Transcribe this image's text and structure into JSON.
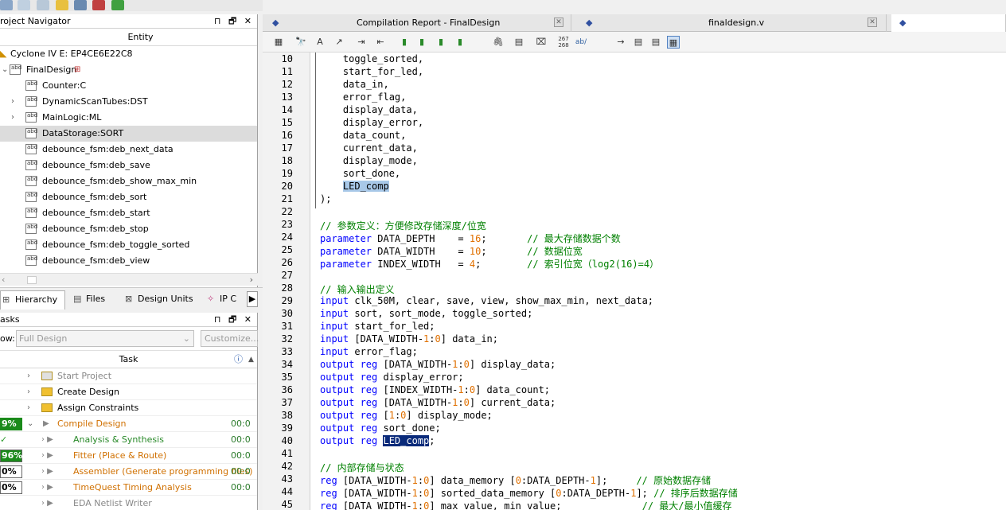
{
  "toolbar_icons": [
    "search-replace-icon",
    "pin-icon",
    "edit-icon",
    "lock-icon",
    "chip-icon",
    "compile-icon",
    "check-icon"
  ],
  "navigator": {
    "title": "roject Navigator",
    "controls": "▏☐✕",
    "column_header": "Entity",
    "device": "Cyclone IV E: EP4CE6E22C8",
    "top": "FinalDesign",
    "items": [
      {
        "label": "Counter:C",
        "expandable": false,
        "selected": false
      },
      {
        "label": "DynamicScanTubes:DST",
        "expandable": true,
        "selected": false
      },
      {
        "label": "MainLogic:ML",
        "expandable": true,
        "selected": false
      },
      {
        "label": "DataStorage:SORT",
        "expandable": false,
        "selected": true
      },
      {
        "label": "debounce_fsm:deb_next_data",
        "expandable": false,
        "selected": false
      },
      {
        "label": "debounce_fsm:deb_save",
        "expandable": false,
        "selected": false
      },
      {
        "label": "debounce_fsm:deb_show_max_min",
        "expandable": false,
        "selected": false
      },
      {
        "label": "debounce_fsm:deb_sort",
        "expandable": false,
        "selected": false
      },
      {
        "label": "debounce_fsm:deb_start",
        "expandable": false,
        "selected": false
      },
      {
        "label": "debounce_fsm:deb_stop",
        "expandable": false,
        "selected": false
      },
      {
        "label": "debounce_fsm:deb_toggle_sorted",
        "expandable": false,
        "selected": false
      },
      {
        "label": "debounce_fsm:deb_view",
        "expandable": false,
        "selected": false
      }
    ],
    "tabs": [
      "Hierarchy",
      "Files",
      "Design Units",
      "IP C"
    ]
  },
  "tasks": {
    "title": "asks",
    "flow_label": "ow:",
    "flow_value": "Full Design",
    "customize": "Customize...",
    "column_header": "Task",
    "rows": [
      {
        "label": "Start Project",
        "style": "gray",
        "pct": "",
        "time": "",
        "folder": true
      },
      {
        "label": "Create Design",
        "style": "normal",
        "pct": "",
        "time": "",
        "folder": true
      },
      {
        "label": "Assign Constraints",
        "style": "normal",
        "pct": "",
        "time": "",
        "folder": true
      },
      {
        "label": "Compile Design",
        "style": "orange",
        "pct": "9%",
        "time": "00:0",
        "folder": false
      },
      {
        "label": "Analysis & Synthesis",
        "style": "green",
        "pct": "",
        "time": "00:0",
        "folder": false
      },
      {
        "label": "Fitter (Place & Route)",
        "style": "orange",
        "pct": "96%",
        "time": "00:0",
        "folder": false
      },
      {
        "label": "Assembler (Generate programming files)",
        "style": "orange",
        "pct": "0%",
        "time": "00:0",
        "folder": false
      },
      {
        "label": "TimeQuest Timing Analysis",
        "style": "orange",
        "pct": "0%",
        "time": "00:0",
        "folder": false
      },
      {
        "label": "EDA Netlist Writer",
        "style": "gray",
        "pct": "",
        "time": "",
        "folder": false
      }
    ]
  },
  "doc_tabs": [
    {
      "label": "Compilation Report - FinalDesign",
      "active": false
    },
    {
      "label": "finaldesign.v",
      "active": false
    },
    {
      "label": "",
      "active": true
    }
  ],
  "editor_icons": [
    "insert-icon",
    "find-icon",
    "replace-icon",
    "goto-icon",
    "indent-icon",
    "outdent-icon",
    "bookmark-icon",
    "bookmark-next-icon",
    "bookmark-prev-icon",
    "bookmark-clear-icon",
    "attach-icon",
    "template-icon",
    "comment-icon",
    "line-numbers-icon",
    "spell-icon",
    "wrap-icon",
    "split-icon",
    "view1-icon",
    "view2-icon"
  ],
  "editor_text_icons": {
    "line_numbers": "267\n268",
    "spell": "ab/"
  },
  "code": [
    {
      "n": "10",
      "parts": [
        [
          "",
          "    toggle_sorted,"
        ]
      ]
    },
    {
      "n": "11",
      "parts": [
        [
          "",
          "    start_for_led,"
        ]
      ]
    },
    {
      "n": "12",
      "parts": [
        [
          "",
          "    data_in,"
        ]
      ]
    },
    {
      "n": "13",
      "parts": [
        [
          "",
          "    error_flag,"
        ]
      ]
    },
    {
      "n": "14",
      "parts": [
        [
          "",
          "    display_data,"
        ]
      ]
    },
    {
      "n": "15",
      "parts": [
        [
          "",
          "    display_error,"
        ]
      ]
    },
    {
      "n": "16",
      "parts": [
        [
          "",
          "    data_count,"
        ]
      ]
    },
    {
      "n": "17",
      "parts": [
        [
          "",
          "    current_data,"
        ]
      ]
    },
    {
      "n": "18",
      "parts": [
        [
          "",
          "    display_mode,"
        ]
      ]
    },
    {
      "n": "19",
      "parts": [
        [
          "",
          "    sort_done,"
        ]
      ]
    },
    {
      "n": "20",
      "parts": [
        [
          "",
          "    "
        ],
        [
          "hl1",
          "LED_comp"
        ]
      ]
    },
    {
      "n": "21",
      "parts": [
        [
          "",
          ");"
        ]
      ]
    },
    {
      "n": "22",
      "parts": [
        [
          "",
          ""
        ]
      ]
    },
    {
      "n": "23",
      "parts": [
        [
          "cm",
          "// 参数定义：方便修改存储深度/位宽"
        ]
      ]
    },
    {
      "n": "24",
      "parts": [
        [
          "kw",
          "parameter"
        ],
        [
          "",
          " DATA_DEPTH    = "
        ],
        [
          "num",
          "16"
        ],
        [
          "",
          ";       "
        ],
        [
          "cm",
          "// 最大存储数据个数"
        ]
      ]
    },
    {
      "n": "25",
      "parts": [
        [
          "kw",
          "parameter"
        ],
        [
          "",
          " DATA_WIDTH    = "
        ],
        [
          "num",
          "10"
        ],
        [
          "",
          ";       "
        ],
        [
          "cm",
          "// 数据位宽"
        ]
      ]
    },
    {
      "n": "26",
      "parts": [
        [
          "kw",
          "parameter"
        ],
        [
          "",
          " INDEX_WIDTH   = "
        ],
        [
          "num",
          "4"
        ],
        [
          "",
          ";        "
        ],
        [
          "cm",
          "// 索引位宽（log2(16)=4）"
        ]
      ]
    },
    {
      "n": "27",
      "parts": [
        [
          "",
          ""
        ]
      ]
    },
    {
      "n": "28",
      "parts": [
        [
          "cm",
          "// 输入输出定义"
        ]
      ]
    },
    {
      "n": "29",
      "parts": [
        [
          "kw",
          "input"
        ],
        [
          "",
          " clk_50M, clear, save, view, show_max_min, next_data;"
        ]
      ]
    },
    {
      "n": "30",
      "parts": [
        [
          "kw",
          "input"
        ],
        [
          "",
          " sort, sort_mode, toggle_sorted;"
        ]
      ]
    },
    {
      "n": "31",
      "parts": [
        [
          "kw",
          "input"
        ],
        [
          "",
          " start_for_led;"
        ]
      ]
    },
    {
      "n": "32",
      "parts": [
        [
          "kw",
          "input"
        ],
        [
          "",
          " [DATA_WIDTH-"
        ],
        [
          "num",
          "1"
        ],
        [
          "",
          ":"
        ],
        [
          "num",
          "0"
        ],
        [
          "",
          "] data_in;"
        ]
      ]
    },
    {
      "n": "33",
      "parts": [
        [
          "kw",
          "input"
        ],
        [
          "",
          " error_flag;"
        ]
      ]
    },
    {
      "n": "34",
      "parts": [
        [
          "kw",
          "output reg"
        ],
        [
          "",
          " [DATA_WIDTH-"
        ],
        [
          "num",
          "1"
        ],
        [
          "",
          ":"
        ],
        [
          "num",
          "0"
        ],
        [
          "",
          "] display_data;"
        ]
      ]
    },
    {
      "n": "35",
      "parts": [
        [
          "kw",
          "output reg"
        ],
        [
          "",
          " display_error;"
        ]
      ]
    },
    {
      "n": "36",
      "parts": [
        [
          "kw",
          "output reg"
        ],
        [
          "",
          " [INDEX_WIDTH-"
        ],
        [
          "num",
          "1"
        ],
        [
          "",
          ":"
        ],
        [
          "num",
          "0"
        ],
        [
          "",
          "] data_count;"
        ]
      ]
    },
    {
      "n": "37",
      "parts": [
        [
          "kw",
          "output reg"
        ],
        [
          "",
          " [DATA_WIDTH-"
        ],
        [
          "num",
          "1"
        ],
        [
          "",
          ":"
        ],
        [
          "num",
          "0"
        ],
        [
          "",
          "] current_data;"
        ]
      ]
    },
    {
      "n": "38",
      "parts": [
        [
          "kw",
          "output reg"
        ],
        [
          "",
          " ["
        ],
        [
          "num",
          "1"
        ],
        [
          "",
          ":"
        ],
        [
          "num",
          "0"
        ],
        [
          "",
          "] display_mode;"
        ]
      ]
    },
    {
      "n": "39",
      "parts": [
        [
          "kw",
          "output reg"
        ],
        [
          "",
          " sort_done;"
        ]
      ]
    },
    {
      "n": "40",
      "parts": [
        [
          "kw",
          "output reg"
        ],
        [
          "",
          " "
        ],
        [
          "hl2",
          "LED_comp"
        ],
        [
          "",
          ";"
        ]
      ]
    },
    {
      "n": "41",
      "parts": [
        [
          "",
          ""
        ]
      ]
    },
    {
      "n": "42",
      "parts": [
        [
          "cm",
          "// 内部存储与状态"
        ]
      ]
    },
    {
      "n": "43",
      "parts": [
        [
          "kw",
          "reg"
        ],
        [
          "",
          " [DATA_WIDTH-"
        ],
        [
          "num",
          "1"
        ],
        [
          "",
          ":"
        ],
        [
          "num",
          "0"
        ],
        [
          "",
          "] data_memory ["
        ],
        [
          "num",
          "0"
        ],
        [
          "",
          ":DATA_DEPTH-"
        ],
        [
          "num",
          "1"
        ],
        [
          "",
          "];     "
        ],
        [
          "cm",
          "// 原始数据存储"
        ]
      ]
    },
    {
      "n": "44",
      "parts": [
        [
          "kw",
          "reg"
        ],
        [
          "",
          " [DATA_WIDTH-"
        ],
        [
          "num",
          "1"
        ],
        [
          "",
          ":"
        ],
        [
          "num",
          "0"
        ],
        [
          "",
          "] sorted_data_memory ["
        ],
        [
          "num",
          "0"
        ],
        [
          "",
          ":DATA_DEPTH-"
        ],
        [
          "num",
          "1"
        ],
        [
          "",
          "]; "
        ],
        [
          "cm",
          "// 排序后数据存储"
        ]
      ]
    },
    {
      "n": "45",
      "parts": [
        [
          "kw",
          "reg"
        ],
        [
          "",
          " [DATA_WIDTH-"
        ],
        [
          "num",
          "1"
        ],
        [
          "",
          ":"
        ],
        [
          "num",
          "0"
        ],
        [
          "",
          "] max_value, min_value;              "
        ],
        [
          "cm",
          "// 最大/最小值缓存"
        ]
      ]
    }
  ]
}
